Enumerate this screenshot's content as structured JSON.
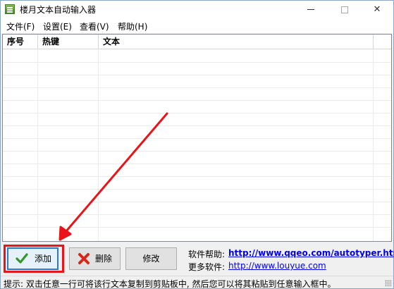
{
  "window": {
    "title": "楼月文本自动输入器",
    "min_icon": "minimize-icon",
    "max_icon": "maximize-icon",
    "close_icon": "close-icon",
    "close_glyph": "✕"
  },
  "menu": [
    {
      "label": "文件(F)"
    },
    {
      "label": "设置(E)"
    },
    {
      "label": "查看(V)"
    },
    {
      "label": "帮助(H)"
    }
  ],
  "table": {
    "columns": [
      "序号",
      "热键",
      "文本"
    ],
    "rows": []
  },
  "buttons": {
    "add": "添加",
    "delete": "删除",
    "edit": "修改"
  },
  "help": {
    "software_help_label": "软件帮助:",
    "software_help_link": "http://www.qqeo.com/autotyper.htm",
    "more_software_label": "更多软件:",
    "more_software_link": "http://www.louyue.com"
  },
  "status": {
    "hint": "提示: 双击任意一行可将该行文本复制到剪贴板中, 然后您可以将其粘贴到任意输入框中。"
  },
  "colors": {
    "highlight_red": "#e8141a",
    "link_blue": "#0000ee",
    "focus_blue": "#2a7ad4"
  }
}
